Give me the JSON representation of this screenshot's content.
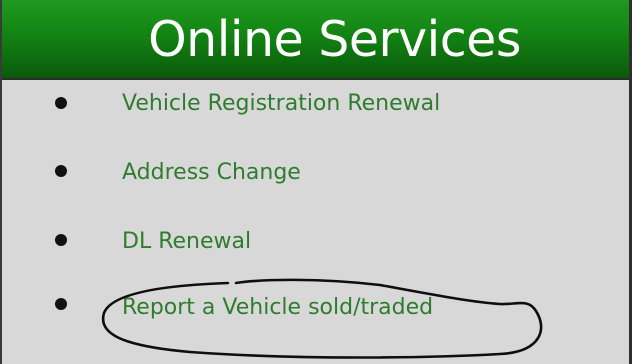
{
  "header": {
    "title": "Online Services"
  },
  "services": [
    {
      "label": "Vehicle Registration Renewal"
    },
    {
      "label": "Address Change"
    },
    {
      "label": "DL Renewal"
    },
    {
      "label": "Report a Vehicle sold/traded"
    }
  ],
  "colors": {
    "header_green": "#138313",
    "link_green": "#2e7d2e",
    "panel_gray": "#d8d8d8"
  }
}
